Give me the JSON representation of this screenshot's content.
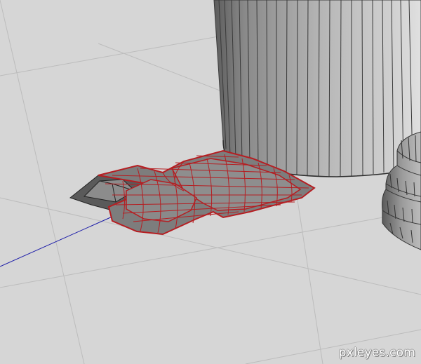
{
  "viewport": {
    "background": "#d6d6d6",
    "grid_color": "#bcbcbc",
    "axis_color": "#1a1aa8",
    "wire_color": "#b51e22",
    "object_color": "#7d7d7d"
  },
  "watermark": {
    "text": "pxleyes.com"
  }
}
